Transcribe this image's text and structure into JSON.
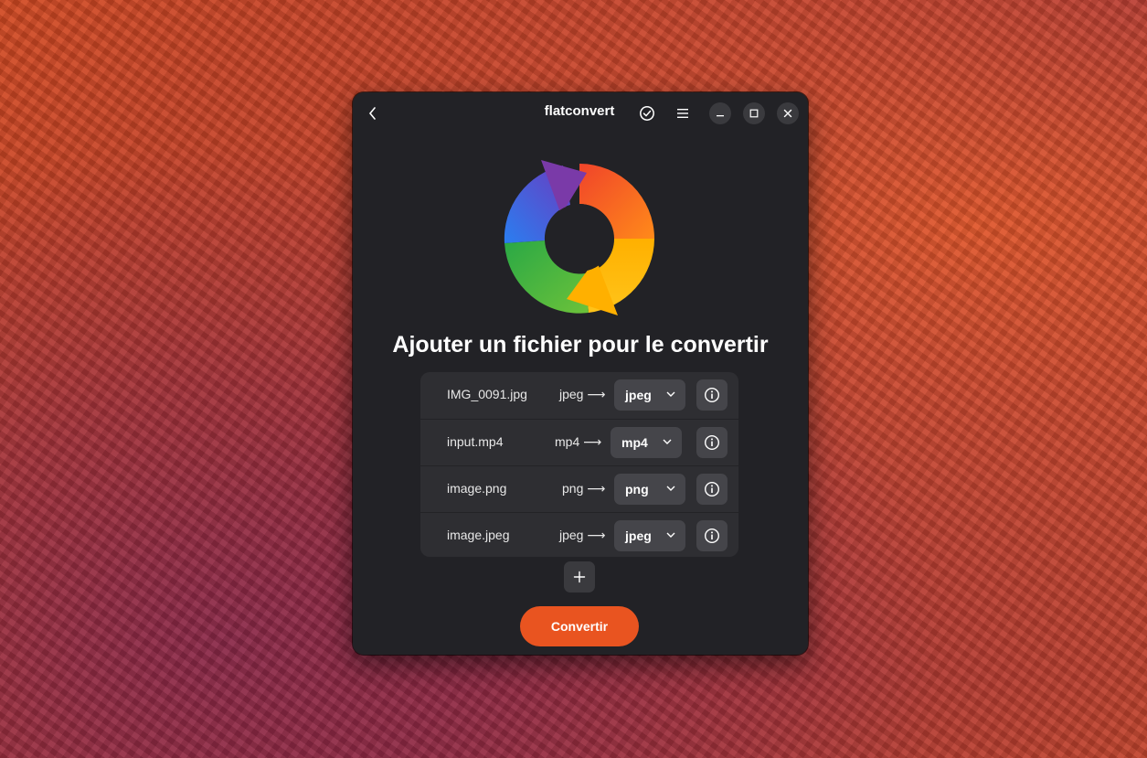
{
  "window": {
    "title": "flatconvert",
    "heading": "Ajouter un fichier pour le convertir"
  },
  "header": {
    "back_icon": "chevron-left-icon",
    "status_icon": "check-circle-icon",
    "menu_icon": "hamburger-menu-icon",
    "minimize_icon": "minimize-icon",
    "maximize_icon": "maximize-icon",
    "close_icon": "close-icon"
  },
  "files": [
    {
      "name": "IMG_0091.jpg",
      "conversion": "jpeg ⟶",
      "target": "jpeg"
    },
    {
      "name": "input.mp4",
      "conversion": "mp4 ⟶",
      "target": "mp4"
    },
    {
      "name": "image.png",
      "conversion": "png ⟶",
      "target": "png"
    },
    {
      "name": "image.jpeg",
      "conversion": "jpeg ⟶",
      "target": "jpeg"
    }
  ],
  "actions": {
    "add_icon": "plus-icon",
    "convert_label": "Convertir"
  },
  "colors": {
    "accent": "#e95420",
    "window_bg": "#222226",
    "list_bg": "#2e2e32"
  }
}
